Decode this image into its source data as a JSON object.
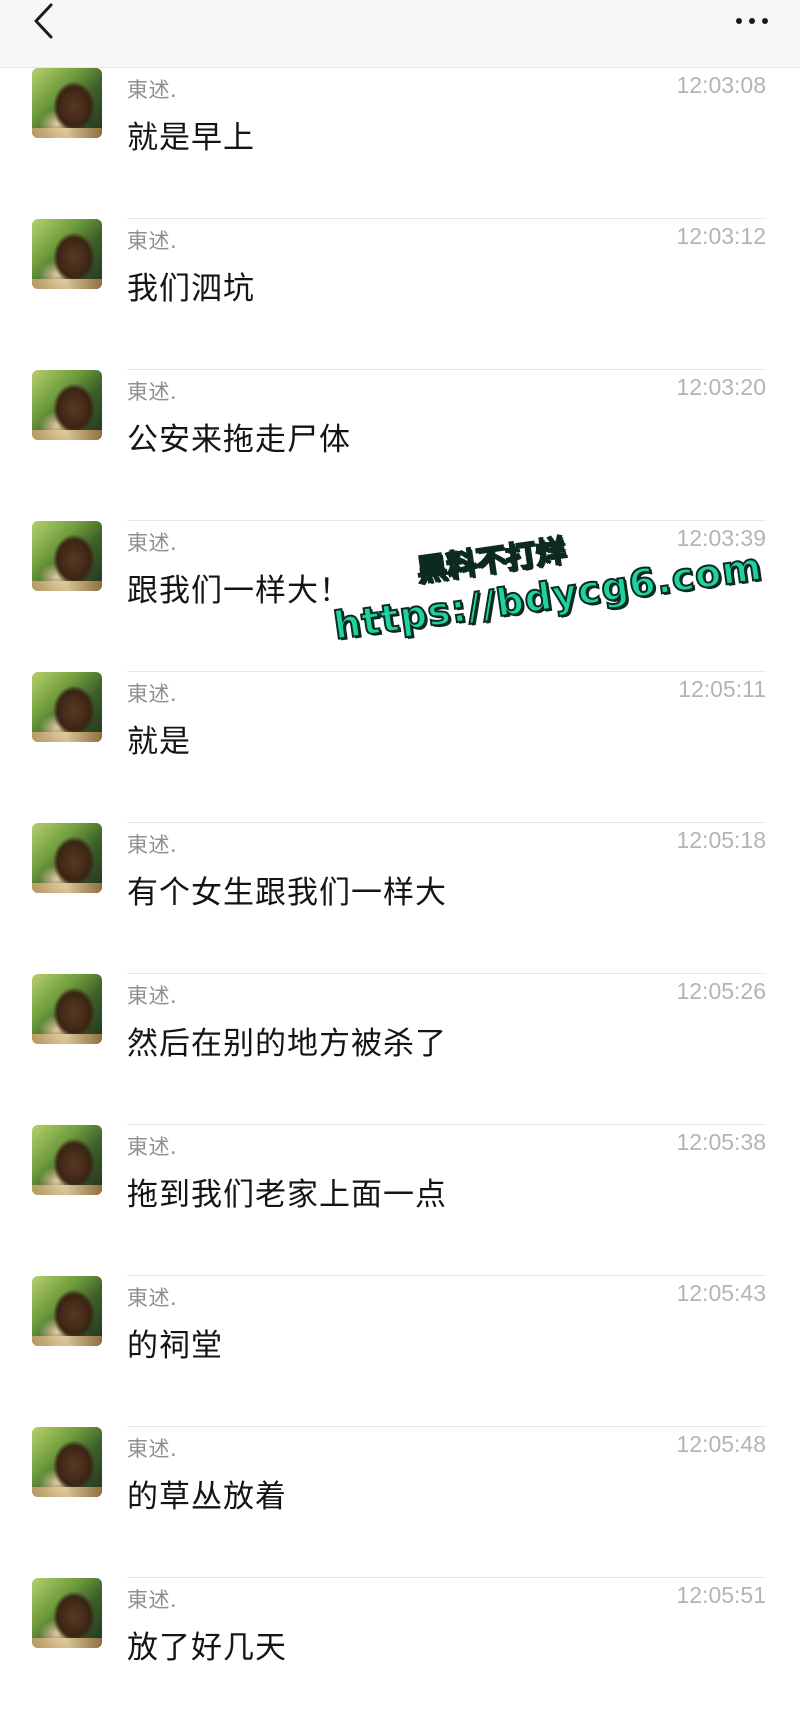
{
  "header": {
    "back_icon": "chevron-left-icon",
    "more_icon": "more-horizontal-icon"
  },
  "messages": [
    {
      "sender": "東述.",
      "time": "12:03:08",
      "text": "就是早上"
    },
    {
      "sender": "東述.",
      "time": "12:03:12",
      "text": "我们泗坑"
    },
    {
      "sender": "東述.",
      "time": "12:03:20",
      "text": "公安来拖走尸体"
    },
    {
      "sender": "東述.",
      "time": "12:03:39",
      "text": "跟我们一样大！"
    },
    {
      "sender": "東述.",
      "time": "12:05:11",
      "text": "就是"
    },
    {
      "sender": "東述.",
      "time": "12:05:18",
      "text": "有个女生跟我们一样大"
    },
    {
      "sender": "東述.",
      "time": "12:05:26",
      "text": "然后在别的地方被杀了"
    },
    {
      "sender": "東述.",
      "time": "12:05:38",
      "text": "拖到我们老家上面一点"
    },
    {
      "sender": "東述.",
      "time": "12:05:43",
      "text": "的祠堂"
    },
    {
      "sender": "東述.",
      "time": "12:05:48",
      "text": "的草丛放着"
    },
    {
      "sender": "東述.",
      "time": "12:05:51",
      "text": "放了好几天"
    }
  ],
  "watermark": {
    "line1": "黑料不打烊",
    "line2": "https://bdycg6.com"
  },
  "colors": {
    "header_bg": "#f7f7f7",
    "name_text": "#8f8f8f",
    "time_text": "#b4b4b4",
    "message_text": "#141414",
    "watermark_fill": "#1fd3a0"
  }
}
